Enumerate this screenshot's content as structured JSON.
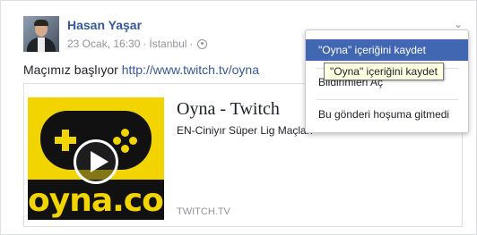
{
  "post": {
    "author": "Hasan Yaşar",
    "timestamp": "23 Ocak, 16:30",
    "separator": "·",
    "location": "İstanbul",
    "text_prefix": "Maçımız başlıyor",
    "text_link": "http://www.twitch.tv/oyna",
    "privacy_icon": "globe-icon",
    "menu_icon": "chevron-down-icon"
  },
  "link_preview": {
    "logo_text": "oyna.com",
    "title": "Oyna - Twitch",
    "description": "EN-Ciniyır Süper Lig Maçları",
    "domain": "TWITCH.TV",
    "thumbnail_color": "#f2d500",
    "play_icon": "play-icon"
  },
  "menu": {
    "items": [
      {
        "label": "\"Oyna\" içeriğini kaydet"
      },
      {
        "label": "Bildirimleri Aç"
      },
      {
        "label": "Bu gönderi hoşuma gitmedi"
      }
    ],
    "active_color": "#4267b2"
  },
  "tooltip": {
    "text": "\"Oyna\" içeriğini kaydet"
  },
  "colors": {
    "link": "#365899",
    "meta": "#90949c"
  }
}
